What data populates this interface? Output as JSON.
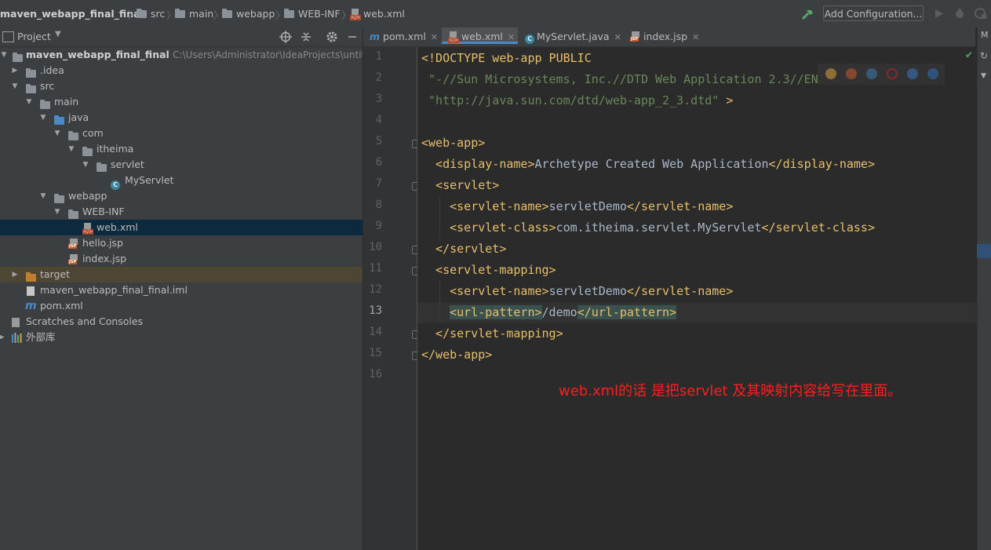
{
  "breadcrumb": [
    "maven_webapp_final_final",
    "src",
    "main",
    "webapp",
    "WEB-INF",
    "web.xml"
  ],
  "toolbar": {
    "add_configuration": "Add Configuration..."
  },
  "project_panel": {
    "title": "Project",
    "tree": [
      {
        "label": "maven_webapp_final_final",
        "path": "C:\\Users\\Administrator\\IdeaProjects\\untitled5",
        "expanded": true
      },
      {
        "label": ".idea",
        "expanded": false
      },
      {
        "label": "src",
        "expanded": true
      },
      {
        "label": "main",
        "expanded": true
      },
      {
        "label": "java",
        "expanded": true
      },
      {
        "label": "com",
        "expanded": true
      },
      {
        "label": "itheima",
        "expanded": true
      },
      {
        "label": "servlet",
        "expanded": true
      },
      {
        "label": "MyServlet"
      },
      {
        "label": "webapp",
        "expanded": true
      },
      {
        "label": "WEB-INF",
        "expanded": true
      },
      {
        "label": "web.xml",
        "selected": true
      },
      {
        "label": "hello.jsp"
      },
      {
        "label": "index.jsp"
      },
      {
        "label": "target",
        "expanded": false
      },
      {
        "label": "maven_webapp_final_final.iml"
      },
      {
        "label": "pom.xml"
      },
      {
        "label": "Scratches and Consoles"
      },
      {
        "label": "外部库"
      }
    ]
  },
  "tabs": [
    {
      "label": "pom.xml"
    },
    {
      "label": "web.xml",
      "active": true
    },
    {
      "label": "MyServlet.java"
    },
    {
      "label": "index.jsp"
    }
  ],
  "right_strip_label": "M",
  "editor": {
    "current_line": 13,
    "line_numbers": [
      "1",
      "2",
      "3",
      "4",
      "5",
      "6",
      "7",
      "8",
      "9",
      "10",
      "11",
      "12",
      "13",
      "14",
      "15",
      "16"
    ],
    "lines": [
      [
        {
          "t": "<!DOCTYPE web-app PUBLIC",
          "c": "tag"
        }
      ],
      [
        {
          "t": " \"-//Sun Microsystems, Inc.//DTD Web Application 2.3//EN\"",
          "c": "str"
        }
      ],
      [
        {
          "t": " \"http://java.sun.com/dtd/web-app_2_3.dtd\"",
          "c": "str"
        },
        {
          "t": " >",
          "c": "tag"
        }
      ],
      [],
      [
        {
          "t": "<web-app>",
          "c": "tag"
        }
      ],
      [
        {
          "t": "  <display-name>",
          "c": "tag"
        },
        {
          "t": "Archetype Created Web Application",
          "c": "txt"
        },
        {
          "t": "</display-name>",
          "c": "tag"
        }
      ],
      [
        {
          "t": "  <servlet>",
          "c": "tag"
        }
      ],
      [
        {
          "t": "    <servlet-name>",
          "c": "tag"
        },
        {
          "t": "servletDemo",
          "c": "txt"
        },
        {
          "t": "</servlet-name>",
          "c": "tag"
        }
      ],
      [
        {
          "t": "    <servlet-class>",
          "c": "tag"
        },
        {
          "t": "com.itheima.servlet.MyServlet",
          "c": "txt"
        },
        {
          "t": "</servlet-class>",
          "c": "tag"
        }
      ],
      [
        {
          "t": "  </servlet>",
          "c": "tag"
        }
      ],
      [
        {
          "t": "  <servlet-mapping>",
          "c": "tag"
        }
      ],
      [
        {
          "t": "    <servlet-name>",
          "c": "tag"
        },
        {
          "t": "servletDemo",
          "c": "txt"
        },
        {
          "t": "</servlet-name>",
          "c": "tag"
        }
      ],
      [
        {
          "t": "    ",
          "c": "txt"
        },
        {
          "t": "<url-pattern>",
          "c": "tag hl"
        },
        {
          "t": "/demo",
          "c": "txt"
        },
        {
          "t": "</url-pattern>",
          "c": "tag hl"
        }
      ],
      [
        {
          "t": "  </servlet-mapping>",
          "c": "tag"
        }
      ],
      [
        {
          "t": "</web-app>",
          "c": "tag"
        }
      ],
      []
    ]
  },
  "annotation": "web.xml的话  是把servlet 及其映射内容给写在里面。",
  "colors": {
    "tag": "#e8bf6a",
    "string": "#6a8759",
    "text": "#a9b7c6",
    "annotation": "#ff1e1e",
    "selection": "#0d293e",
    "accent": "#4a88c7"
  }
}
